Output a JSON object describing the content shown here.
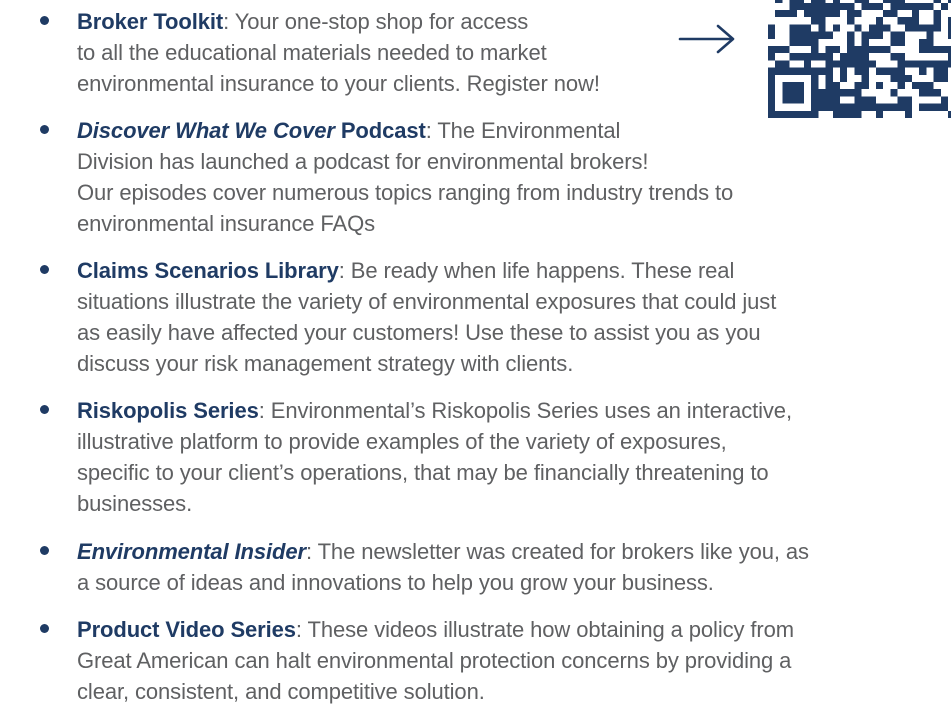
{
  "items": [
    {
      "title": "Broker Toolkit",
      "title_italic": false,
      "suffix": "",
      "lines": [
        ": Your one-stop shop for access",
        "to all the educational materials needed to market",
        "environmental insurance to your clients. Register now!"
      ]
    },
    {
      "title": "Discover What We Cover",
      "title_italic": true,
      "suffix": " Podcast",
      "lines": [
        ": The Environmental",
        "Division has launched a podcast for environmental brokers!",
        "Our episodes cover numerous topics ranging from industry trends to",
        "environmental insurance FAQs"
      ]
    },
    {
      "title": "Claims Scenarios Library",
      "title_italic": false,
      "suffix": "",
      "lines": [
        ": Be ready when life happens. These real",
        "situations illustrate the variety of environmental exposures that could just",
        "as easily have affected your customers! Use these to assist you as you",
        "discuss your risk management strategy with clients."
      ]
    },
    {
      "title": "Riskopolis Series",
      "title_italic": false,
      "suffix": "",
      "lines": [
        ": Environmental’s Riskopolis Series uses an interactive,",
        "illustrative platform to provide examples of the variety of exposures,",
        "specific to your client’s operations, that may be financially threatening to",
        "businesses."
      ]
    },
    {
      "title": "Environmental Insider",
      "title_italic": true,
      "suffix": "",
      "lines": [
        ": The newsletter was created for brokers like you, as",
        "a source of ideas and innovations to help you grow your business."
      ]
    },
    {
      "title": "Product Video Series",
      "title_italic": false,
      "suffix": "",
      "lines": [
        ": These videos illustrate how obtaining a policy from",
        "Great American can halt environmental protection concerns by providing a",
        "clear, consistent, and competitive solution."
      ]
    }
  ],
  "colors": {
    "accent": "#1f3b64",
    "body_text": "#5f6062",
    "background": "#ffffff"
  },
  "icons": {
    "arrow": "arrow-right-icon",
    "qr": "qr-code-icon"
  }
}
